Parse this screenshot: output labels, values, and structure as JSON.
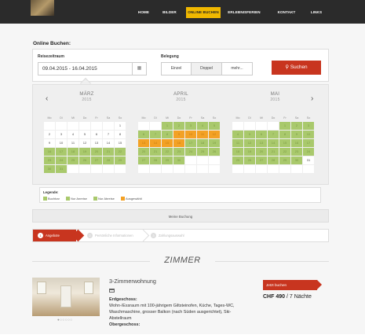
{
  "nav": {
    "items": [
      "HOME",
      "BILDER",
      "ONLINE BUCHEN",
      "ERLEBNISFERIEN",
      "KONTAKT",
      "LINKS"
    ],
    "active_index": 2
  },
  "booking": {
    "title": "Online Buchen:",
    "period_label": "Reisezeitraum",
    "date_range": "09.04.2015 - 16.04.2015",
    "occupancy_label": "Belegung",
    "occupancy_options": [
      "Einzel",
      "Doppel",
      "mehr..."
    ],
    "occupancy_selected": "Doppel",
    "search_label": "Suchen"
  },
  "calendar": {
    "weekdays": [
      "Mo",
      "Di",
      "Mi",
      "Do",
      "Fr",
      "Sa",
      "So"
    ],
    "months": [
      {
        "name": "MÄRZ",
        "year": "2015",
        "offset": 6,
        "days": 31,
        "green": [
          16,
          17,
          18,
          19,
          20,
          21,
          22,
          23,
          24,
          25,
          26,
          27,
          28,
          29,
          30,
          31
        ],
        "orange": []
      },
      {
        "name": "APRIL",
        "year": "2015",
        "offset": 2,
        "days": 30,
        "green": [
          1,
          2,
          3,
          4,
          5,
          6,
          7,
          8,
          17,
          18,
          19,
          20,
          21,
          22,
          23,
          24,
          25,
          26,
          27,
          28,
          29,
          30
        ],
        "orange": [
          9,
          10,
          11,
          12,
          13,
          14,
          15,
          16
        ]
      },
      {
        "name": "MAI",
        "year": "2015",
        "offset": 4,
        "days": 31,
        "green": [
          1,
          2,
          3,
          4,
          5,
          6,
          7,
          8,
          9,
          10,
          11,
          12,
          13,
          14,
          15,
          16,
          17,
          18,
          19,
          20,
          21,
          22,
          23,
          24,
          25,
          26,
          27,
          28,
          29,
          30
        ],
        "orange": []
      }
    ]
  },
  "legend": {
    "heading": "Legende:",
    "items": [
      {
        "label": "Buchbar",
        "color": "#a9c96c"
      },
      {
        "label": "Nur Anreise",
        "color": "#a9c96c"
      },
      {
        "label": "Nur Abreise",
        "color": "#a9c96c"
      },
      {
        "label": "Ausgewählt",
        "color": "#f3a125"
      }
    ]
  },
  "my_booking": "Meine Buchung",
  "steps": [
    {
      "num": "1",
      "label": "Angebote"
    },
    {
      "num": "2",
      "label": "Persönliche Informationen"
    },
    {
      "num": "3",
      "label": "Zahlungsauswahl"
    }
  ],
  "rooms_heading": "ZIMMER",
  "room": {
    "title": "3-Zimmerwohnung",
    "ground_floor_heading": "Erdgeschoss:",
    "ground_floor_text": "Wohn-/Essraum mit 100-jährigem Giltsteinofen, Küche, Tages-WC, Waschmaschine, grosser Balkon (nach Süden ausgerichtet), Ski-Abstellraum",
    "upper_floor_heading": "Obergeschoss:",
    "book_label": "Jetzt buchen",
    "price": "CHF 490",
    "nights": "/ 7 Nächte"
  },
  "colors": {
    "accent": "#c8351f",
    "nav_active": "#f0b800",
    "available": "#a9c96c",
    "selected": "#f3a125"
  }
}
